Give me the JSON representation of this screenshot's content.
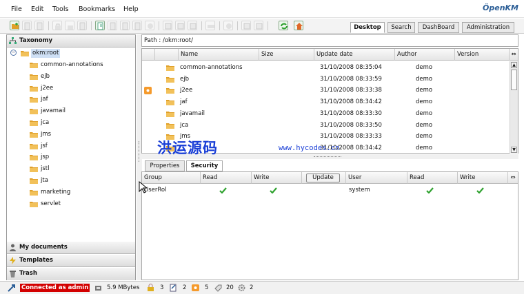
{
  "menu": {
    "items": [
      "File",
      "Edit",
      "Tools",
      "Bookmarks",
      "Help"
    ],
    "logo": "penKM",
    "logo_prefix": "Ö"
  },
  "toolbar": {
    "icons": [
      "create-folder-icon",
      "find-folder-icon",
      "find-document-icon",
      "lock-icon",
      "unlock-icon",
      "add-document-icon",
      "delete-icon",
      "checkout-icon",
      "checkin-icon",
      "cancel-checkout-icon",
      "copy-icon",
      "paste-icon",
      "scanner-icon",
      "add-bookmark-icon",
      "home-icon",
      "refresh-icon",
      "home-bookmark-icon"
    ]
  },
  "main_tabs": [
    "Desktop",
    "Search",
    "DashBoard",
    "Administration"
  ],
  "sidebar": {
    "header": "Taxonomy",
    "root": "okm:root",
    "folders": [
      "common-annotations",
      "ejb",
      "j2ee",
      "jaf",
      "javamail",
      "jca",
      "jms",
      "jsf",
      "jsp",
      "jstl",
      "jta",
      "marketing",
      "servlet"
    ],
    "bottom_sections": [
      "My documents",
      "Templates",
      "Trash"
    ]
  },
  "path": {
    "label": "Path :",
    "value": "/okm:root/"
  },
  "grid": {
    "columns": [
      "Name",
      "Size",
      "Update date",
      "Author",
      "Version"
    ],
    "rows": [
      {
        "name": "common-annotations",
        "size": "",
        "date": "31/10/2008 08:35:04",
        "author": "demo",
        "version": ""
      },
      {
        "name": "ejb",
        "size": "",
        "date": "31/10/2008 08:33:59",
        "author": "demo",
        "version": ""
      },
      {
        "name": "j2ee",
        "size": "",
        "date": "31/10/2008 08:33:38",
        "author": "demo",
        "version": ""
      },
      {
        "name": "jaf",
        "size": "",
        "date": "31/10/2008 08:34:42",
        "author": "demo",
        "version": ""
      },
      {
        "name": "javamail",
        "size": "",
        "date": "31/10/2008 08:33:30",
        "author": "demo",
        "version": ""
      },
      {
        "name": "jca",
        "size": "",
        "date": "31/10/2008 08:33:50",
        "author": "demo",
        "version": ""
      },
      {
        "name": "jms",
        "size": "",
        "date": "31/10/2008 08:33:33",
        "author": "demo",
        "version": ""
      },
      {
        "name": "",
        "size": "",
        "date": "31/10/2008 08:34:42",
        "author": "demo",
        "version": ""
      }
    ]
  },
  "properties_tabs": [
    "Properties",
    "Security"
  ],
  "security": {
    "columns_left": [
      "Group",
      "Read",
      "Write"
    ],
    "update_label": "Update",
    "columns_right": [
      "User",
      "Read",
      "Write"
    ],
    "group_rows": [
      {
        "name": "UserRol",
        "read": true,
        "write": true
      }
    ],
    "user_rows": [
      {
        "name": "system",
        "read": true,
        "write": true
      }
    ]
  },
  "status": {
    "connected": "Connected as admin",
    "quota": "5.9 MBytes",
    "locked": "3",
    "checkout": "2",
    "subscribed": "5",
    "news": "20",
    "workflows": "2"
  },
  "watermark": {
    "text": "洪运源码",
    "url": "www.hycodes.cn"
  },
  "colors": {
    "connected_bg": "#d30000",
    "folder": "#e0a02a",
    "check": "#2ea12e",
    "watermark": "#1a3fd6",
    "logo": "#2a5d96"
  }
}
